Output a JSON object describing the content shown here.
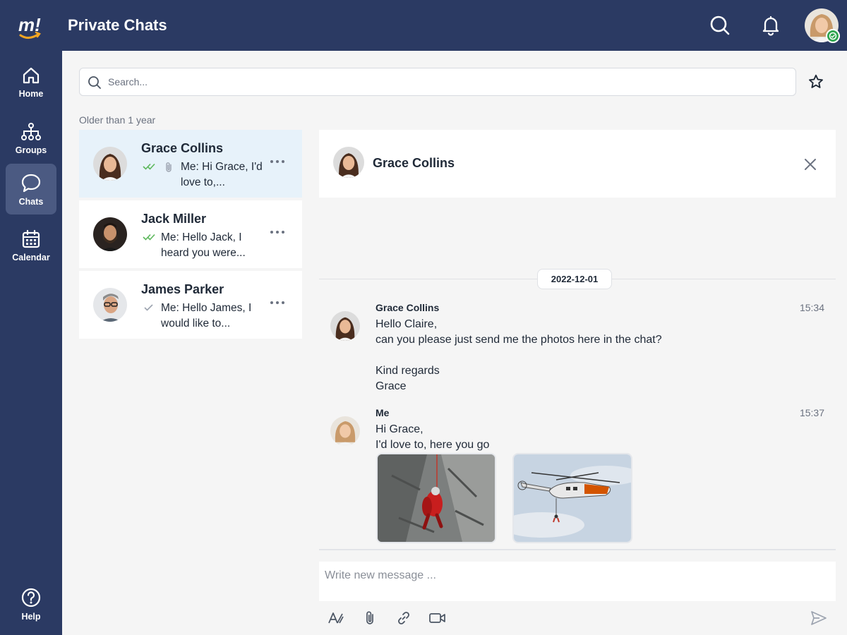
{
  "app": {
    "title": "Private Chats"
  },
  "colors": {
    "primary": "#2b3a63",
    "active_nav": "#4b5a82",
    "selected_row": "#e7f2fa",
    "read_tick": "#5cb85c",
    "online": "#2ea44f"
  },
  "sidebar": {
    "items": [
      {
        "label": "Home",
        "icon": "home-icon",
        "active": false
      },
      {
        "label": "Groups",
        "icon": "org-chart-icon",
        "active": false
      },
      {
        "label": "Chats",
        "icon": "speech-bubble-icon",
        "active": true
      },
      {
        "label": "Calendar",
        "icon": "calendar-icon",
        "active": false
      }
    ],
    "help": {
      "label": "Help",
      "icon": "help-circle-icon"
    }
  },
  "search": {
    "placeholder": "Search...",
    "value": ""
  },
  "chat_list": {
    "section_label": "Older than 1 year",
    "items": [
      {
        "name": "Grace Collins",
        "preview": "Me: Hi Grace, I'd love to,...",
        "status": "read",
        "has_attachment": true,
        "selected": true
      },
      {
        "name": "Jack Miller",
        "preview": "Me: Hello Jack, I heard you were...",
        "status": "read",
        "has_attachment": false,
        "selected": false
      },
      {
        "name": "James Parker",
        "preview": "Me: Hello James, I would like to...",
        "status": "sent",
        "has_attachment": false,
        "selected": false
      }
    ]
  },
  "conversation": {
    "header_name": "Grace Collins",
    "date": "2022-12-01",
    "messages": [
      {
        "sender": "Grace Collins",
        "time": "15:34",
        "lines": [
          "Hello Claire,",
          "can you please just send me the photos here in the chat?",
          "",
          "Kind regards",
          "Grace"
        ]
      },
      {
        "sender": "Me",
        "time": "15:37",
        "lines": [
          "Hi Grace,",
          "I'd love to, here you go"
        ],
        "attachments": [
          "rescue-climb-photo",
          "rescue-helicopter-photo"
        ]
      }
    ]
  },
  "composer": {
    "placeholder": "Write new message ...",
    "value": "",
    "tools": [
      "text-format-icon",
      "paperclip-icon",
      "link-icon",
      "video-camera-icon"
    ],
    "send_icon": "send-icon"
  }
}
